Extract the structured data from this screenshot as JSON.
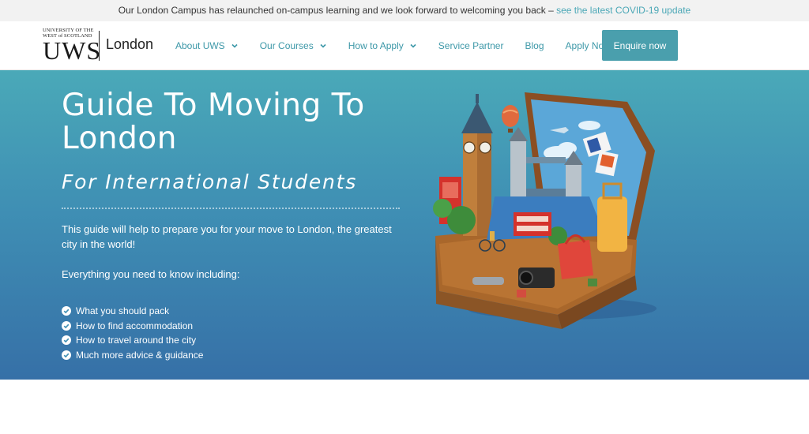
{
  "notice": {
    "text": "Our London Campus has relaunched on-campus learning and we look forward to welcoming you back –",
    "link": "see the latest COVID-19 update"
  },
  "logo": {
    "line1": "UNIVERSITY OF THE",
    "line2": "WEST of SCOTLAND",
    "mark": "UWS",
    "city": "London"
  },
  "nav": {
    "items": [
      {
        "label": "About UWS",
        "dropdown": true
      },
      {
        "label": "Our Courses",
        "dropdown": true
      },
      {
        "label": "How to Apply",
        "dropdown": true
      },
      {
        "label": "Service Partner",
        "dropdown": false
      },
      {
        "label": "Blog",
        "dropdown": false
      },
      {
        "label": "Apply Now",
        "dropdown": false
      }
    ],
    "enquire": "Enquire now"
  },
  "hero": {
    "title": "Guide To Moving To London",
    "subtitle": "For International Students",
    "intro": "This guide will help to prepare you for your move to London, the greatest city in the world!",
    "lead": "Everything you need to know including:",
    "checklist": [
      "What you should pack",
      "How to find accommodation",
      "How to travel around the city",
      "Much more advice & guidance"
    ]
  },
  "colors": {
    "accent": "#3d98a8",
    "button": "#4a9fad",
    "hero_top": "#4aa9b8",
    "hero_bottom": "#3670a7"
  }
}
